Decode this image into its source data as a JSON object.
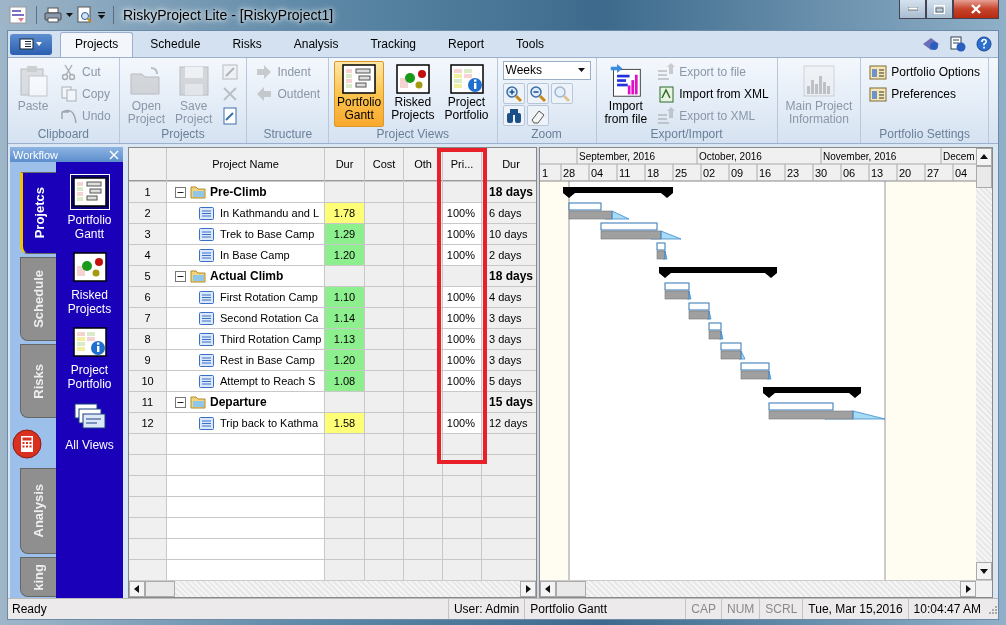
{
  "window": {
    "title": "RiskyProject Lite - [RiskyProject1]"
  },
  "tabs": [
    {
      "label": "Projects",
      "selected": true
    },
    {
      "label": "Schedule",
      "selected": false
    },
    {
      "label": "Risks",
      "selected": false
    },
    {
      "label": "Analysis",
      "selected": false
    },
    {
      "label": "Tracking",
      "selected": false
    },
    {
      "label": "Report",
      "selected": false
    },
    {
      "label": "Tools",
      "selected": false
    }
  ],
  "ribbon": {
    "groups": [
      {
        "label": "Clipboard",
        "items": [
          {
            "kind": "large",
            "label": "Paste",
            "disabled": true
          },
          {
            "kind": "small",
            "label": "Cut",
            "disabled": true
          },
          {
            "kind": "small",
            "label": "Copy",
            "disabled": true
          },
          {
            "kind": "small",
            "label": "Undo",
            "disabled": true
          }
        ]
      },
      {
        "label": "Projects",
        "items": [
          {
            "kind": "large",
            "label": "Open\nProject",
            "disabled": true
          },
          {
            "kind": "large",
            "label": "Save\nProject",
            "disabled": true
          },
          {
            "kind": "icons",
            "buttons": [
              {
                "disabled": true
              }
            ]
          },
          {
            "kind": "icons",
            "buttons": [
              {
                "disabled": true
              }
            ]
          },
          {
            "kind": "icons",
            "buttons": [
              {
                "disabled": false
              }
            ]
          }
        ]
      },
      {
        "label": "Structure",
        "items": [
          {
            "kind": "small",
            "label": "Indent",
            "disabled": true
          },
          {
            "kind": "small",
            "label": "Outdent",
            "disabled": true
          }
        ]
      },
      {
        "label": "Project Views",
        "items": [
          {
            "kind": "large",
            "label": "Portfolio\nGantt",
            "selected": true
          },
          {
            "kind": "large",
            "label": "Risked\nProjects",
            "selected": false
          },
          {
            "kind": "large",
            "label": "Project\nPortfolio",
            "selected": false
          }
        ]
      },
      {
        "label": "Zoom",
        "items": [
          {
            "kind": "combo",
            "value": "Weeks"
          },
          {
            "kind": "icons",
            "buttons": [
              {
                "disabled": false
              },
              {
                "disabled": false
              },
              {
                "disabled": true
              }
            ]
          },
          {
            "kind": "icons",
            "buttons": [
              {
                "disabled": false
              },
              {
                "disabled": false
              }
            ]
          }
        ]
      },
      {
        "label": "Export/Import",
        "items": [
          {
            "kind": "large",
            "label": "Import\nfrom file",
            "disabled": false
          },
          {
            "kind": "small",
            "label": "Export to file",
            "disabled": true
          },
          {
            "kind": "small",
            "label": "Import from XML",
            "disabled": false
          },
          {
            "kind": "small",
            "label": "Export to XML",
            "disabled": true
          }
        ]
      },
      {
        "items": [
          {
            "kind": "large",
            "label": "Main Project\nInformation",
            "disabled": true
          }
        ]
      },
      {
        "label": "Portfolio Settings",
        "items": [
          {
            "kind": "small",
            "label": "Portfolio Options",
            "disabled": false
          },
          {
            "kind": "small",
            "label": "Preferences",
            "disabled": false
          }
        ]
      }
    ]
  },
  "workflow": {
    "title": "Workflow",
    "tabs": [
      {
        "kind": "tab",
        "label": "Projetcs",
        "selected": true
      },
      {
        "kind": "tab",
        "label": "Schedule",
        "selected": false
      },
      {
        "kind": "tab",
        "label": "Risks",
        "selected": false
      },
      {
        "kind": "button"
      },
      {
        "kind": "tab",
        "label": "Analysis",
        "selected": false
      },
      {
        "kind": "tab",
        "label": "king",
        "selected": false
      }
    ],
    "items": [
      {
        "label": "Portfolio\nGantt",
        "selected": true
      },
      {
        "label": "Risked\nProjects",
        "selected": false
      },
      {
        "label": "Project\nPortfolio",
        "selected": false
      },
      {
        "label": "All Views",
        "selected": false
      }
    ]
  },
  "table": {
    "columns": [
      {
        "highlighted": false
      },
      {
        "label": "Project Name",
        "highlighted": false
      },
      {
        "label": "Dur",
        "highlighted": false
      },
      {
        "label": "Cost",
        "highlighted": false
      },
      {
        "label": "Oth",
        "highlighted": false
      },
      {
        "label": "Pri...",
        "highlighted": true
      },
      {
        "label": "Dur",
        "highlighted": false
      }
    ],
    "rows": [
      {
        "num": "1",
        "kind": "summary",
        "expanded": true,
        "name": "Pre-Climb",
        "duration": "18 days"
      },
      {
        "num": "2",
        "kind": "task",
        "name": "In Kathmandu and L",
        "factor": "1.78",
        "color": "#ffff77",
        "priority": "100%",
        "duration": "6 days"
      },
      {
        "num": "3",
        "kind": "task",
        "name": "Trek to Base Camp",
        "factor": "1.29",
        "color": "#8eef8e",
        "priority": "100%",
        "duration": "10 days"
      },
      {
        "num": "4",
        "kind": "task",
        "name": "In Base Camp",
        "factor": "1.20",
        "color": "#8eef8e",
        "priority": "100%",
        "duration": "2 days"
      },
      {
        "num": "5",
        "kind": "summary",
        "expanded": true,
        "name": "Actual Climb",
        "duration": "18 days"
      },
      {
        "num": "6",
        "kind": "task",
        "name": "First Rotation Camp",
        "factor": "1.10",
        "color": "#8eef8e",
        "priority": "100%",
        "duration": "4 days"
      },
      {
        "num": "7",
        "kind": "task",
        "name": "Second Rotation Ca",
        "factor": "1.14",
        "color": "#8eef8e",
        "priority": "100%",
        "duration": "3 days"
      },
      {
        "num": "8",
        "kind": "task",
        "name": "Third Rotation Camp",
        "factor": "1.13",
        "color": "#8eef8e",
        "priority": "100%",
        "duration": "3 days"
      },
      {
        "num": "9",
        "kind": "task",
        "name": "Rest in Base Camp",
        "factor": "1.20",
        "color": "#8eef8e",
        "priority": "100%",
        "duration": "3 days"
      },
      {
        "num": "10",
        "kind": "task",
        "name": "Attempt to Reach S",
        "factor": "1.08",
        "color": "#8eef8e",
        "priority": "100%",
        "duration": "5 days"
      },
      {
        "num": "11",
        "kind": "summary",
        "expanded": true,
        "name": "Departure",
        "duration": "15 days"
      },
      {
        "num": "12",
        "kind": "task",
        "name": "Trip back to Kathma",
        "factor": "1.58",
        "color": "#ffff77",
        "priority": "100%",
        "duration": "12 days"
      }
    ]
  },
  "gantt": {
    "months": [
      "September, 2016",
      "October, 2016",
      "November, 2016",
      "Decem"
    ],
    "weeks": [
      "1",
      "28",
      "04",
      "11",
      "18",
      "25",
      "02",
      "09",
      "16",
      "23",
      "30",
      "06",
      "13",
      "20",
      "27",
      "04"
    ]
  },
  "status_bar": {
    "message": "Ready",
    "user": "User: Admin",
    "view": "Portfolio Gantt",
    "indicators": [
      {
        "label": "CAP",
        "on": false
      },
      {
        "label": "NUM",
        "on": false
      },
      {
        "label": "SCRL",
        "on": false
      }
    ],
    "date": "Tue, Mar 15,2016",
    "time": "10:04:47 AM"
  }
}
